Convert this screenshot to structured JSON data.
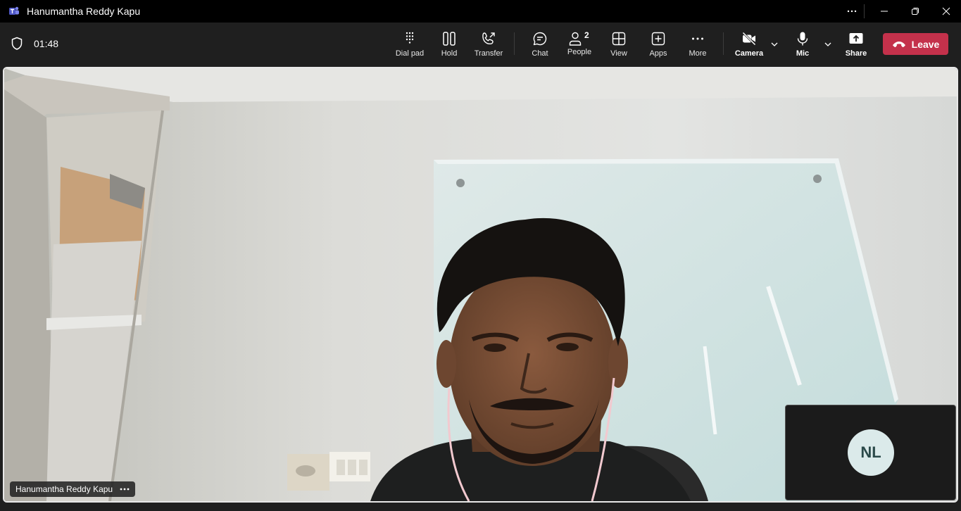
{
  "window": {
    "title": "Hanumantha Reddy Kapu",
    "app_icon": "teams-logo-icon",
    "more_icon": "ellipsis-icon",
    "minimize_icon": "minimize-icon",
    "restore_icon": "restore-icon",
    "close_icon": "close-icon"
  },
  "call": {
    "duration": "01:48",
    "security_icon": "shield-icon"
  },
  "toolbar": {
    "dial_pad": "Dial pad",
    "hold": "Hold",
    "transfer": "Transfer",
    "chat": "Chat",
    "people": "People",
    "people_count": "2",
    "view": "View",
    "apps": "Apps",
    "more": "More",
    "camera": "Camera",
    "mic": "Mic",
    "share": "Share",
    "leave": "Leave"
  },
  "stage": {
    "participant_name": "Hanumantha Reddy Kapu",
    "self_initials": "NL"
  },
  "colors": {
    "leave": "#c4314b",
    "toolbar_bg": "#1f1f1f",
    "titlebar_bg": "#000000",
    "avatar_bg": "#dbeaea"
  }
}
